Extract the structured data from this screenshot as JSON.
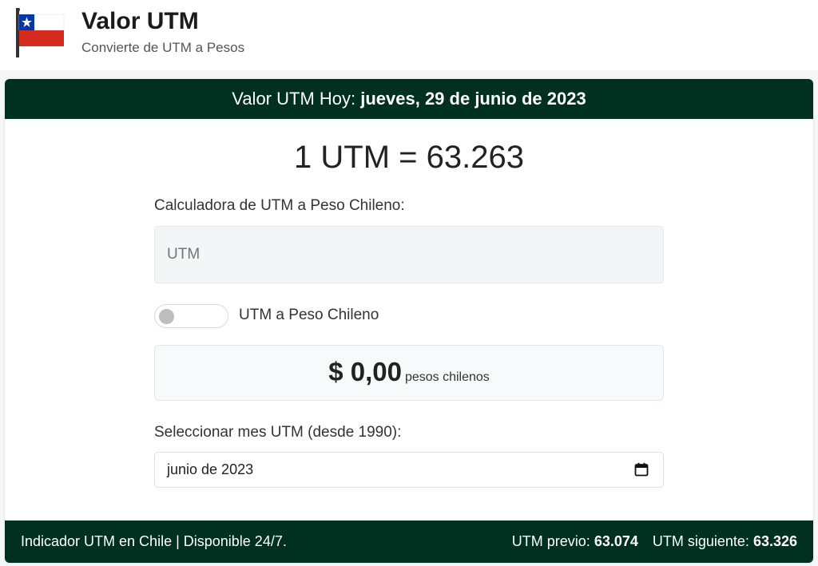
{
  "header": {
    "title": "Valor UTM",
    "subtitle": "Convierte de UTM a Pesos",
    "flag_icon": "chile-flag-icon"
  },
  "card": {
    "heading_prefix": "Valor UTM Hoy: ",
    "heading_date": "jueves, 29 de junio de 2023",
    "rate_text": "1 UTM = 63.263"
  },
  "calculator": {
    "label": "Calculadora de UTM a Peso Chileno:",
    "input_placeholder": "UTM",
    "input_value": "",
    "toggle_on": false,
    "toggle_label": "UTM a Peso Chileno",
    "result_amount": "$ 0,00",
    "result_unit": "pesos chilenos"
  },
  "month": {
    "label": "Seleccionar mes UTM (desde 1990):",
    "value": "junio de 2023",
    "icon": "calendar-icon"
  },
  "footer": {
    "left_text": "Indicador UTM en Chile | Disponible 24/7.",
    "prev_label": "UTM previo: ",
    "prev_value": "63.074",
    "next_label": "UTM siguiente: ",
    "next_value": "63.326"
  },
  "colors": {
    "primary_dark_green": "#003020",
    "flag_red": "#d52b1e",
    "flag_blue": "#0039a6",
    "flag_white": "#ffffff"
  }
}
